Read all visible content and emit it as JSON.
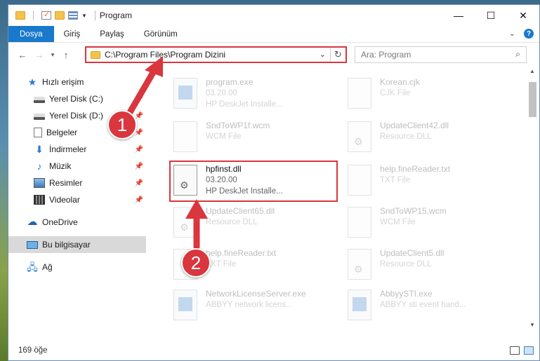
{
  "window": {
    "title": "Program",
    "controls": {
      "minimize": "—",
      "maximize": "☐",
      "close": "✕"
    }
  },
  "ribbon": {
    "tabs": [
      "Dosya",
      "Giriş",
      "Paylaş",
      "Görünüm"
    ]
  },
  "navigation": {
    "back": "←",
    "forward": "→",
    "recent": "▾",
    "up": "↑",
    "address_path": "C:\\Program Files\\Program Dizini",
    "search_placeholder": "Ara: Program"
  },
  "sidebar": {
    "items": [
      {
        "label": "Hızlı erişim",
        "icon": "star-icon"
      },
      {
        "label": "Yerel Disk (C:)",
        "icon": "disk-icon",
        "pinned": true
      },
      {
        "label": "Yerel Disk (D:)",
        "icon": "disk-icon",
        "pinned": true
      },
      {
        "label": "Belgeler",
        "icon": "documents-icon",
        "pinned": true
      },
      {
        "label": "İndirmeler",
        "icon": "downloads-icon",
        "pinned": true
      },
      {
        "label": "Müzik",
        "icon": "music-icon",
        "pinned": true
      },
      {
        "label": "Resimler",
        "icon": "pictures-icon",
        "pinned": true
      },
      {
        "label": "Videolar",
        "icon": "videos-icon",
        "pinned": true
      },
      {
        "label": "OneDrive",
        "icon": "onedrive-icon"
      },
      {
        "label": "Bu bilgisayar",
        "icon": "computer-icon",
        "selected": true
      },
      {
        "label": "Ağ",
        "icon": "network-icon"
      }
    ]
  },
  "files": [
    {
      "name": "program.exe",
      "line2": "03.20.00",
      "line3": "HP DeskJet Installe...",
      "type": "exe"
    },
    {
      "name": "Korean.cjk",
      "line2": "CJK File",
      "line3": "",
      "type": "file"
    },
    {
      "name": "SndToWP1f.wcm",
      "line2": "WCM File",
      "line3": "",
      "type": "file"
    },
    {
      "name": "UpdateClient42.dll",
      "line2": "Resource DLL",
      "line3": "",
      "type": "dll"
    },
    {
      "name": "hpfinst.dll",
      "line2": "03.20.00",
      "line3": "HP DeskJet Installe...",
      "type": "dll",
      "highlighted": true
    },
    {
      "name": "help.fineReader.txt",
      "line2": "TXT File",
      "line3": "",
      "type": "file"
    },
    {
      "name": "UpdateClient65.dll",
      "line2": "Resource DLL",
      "line3": "",
      "type": "dll"
    },
    {
      "name": "SndToWP15.wcm",
      "line2": "WCM File",
      "line3": "",
      "type": "file"
    },
    {
      "name": "help.fineReader.txt",
      "line2": "TXT File",
      "line3": "",
      "type": "file"
    },
    {
      "name": "UpdateClient5.dll",
      "line2": "Resource DLL",
      "line3": "",
      "type": "dll"
    },
    {
      "name": "NetworkLicenseServer.exe",
      "line2": "ABBYY network licens...",
      "line3": "",
      "type": "exe"
    },
    {
      "name": "AbbyySTI.exe",
      "line2": "ABBYY sti event hand...",
      "line3": "",
      "type": "exe"
    }
  ],
  "status": {
    "item_count": "169 öğe"
  },
  "markers": [
    "1",
    "2"
  ],
  "colors": {
    "accent": "#1979ca",
    "highlight": "#d9363e"
  }
}
